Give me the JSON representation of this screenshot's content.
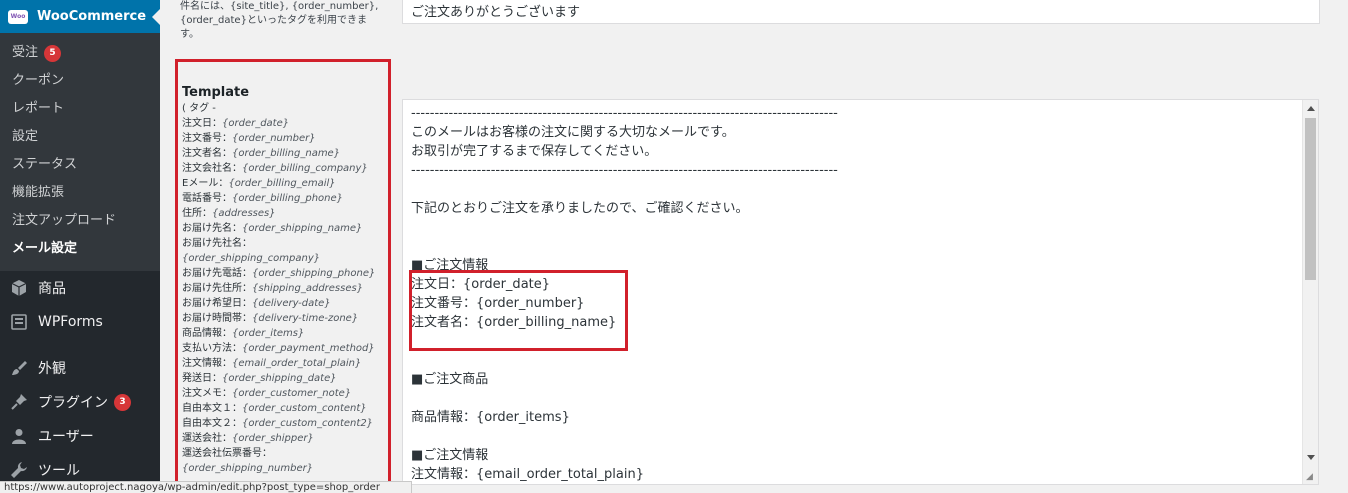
{
  "sidebar": {
    "woocommerce": {
      "logo_text": "Woo",
      "title": "WooCommerce"
    },
    "submenu": [
      {
        "label": "受注",
        "badge": "5"
      },
      {
        "label": "クーポン"
      },
      {
        "label": "レポート"
      },
      {
        "label": "設定"
      },
      {
        "label": "ステータス"
      },
      {
        "label": "機能拡張"
      },
      {
        "label": "注文アップロード"
      },
      {
        "label": "メール設定",
        "current": true
      }
    ],
    "menu": [
      {
        "label": "商品",
        "icon": "box-icon"
      },
      {
        "label": "WPForms",
        "icon": "forms-icon"
      },
      {
        "label": "外観",
        "icon": "brush-icon"
      },
      {
        "label": "プラグイン",
        "icon": "plugin-icon",
        "badge": "3"
      },
      {
        "label": "ユーザー",
        "icon": "user-icon"
      },
      {
        "label": "ツール",
        "icon": "wrench-icon"
      }
    ]
  },
  "subject": {
    "description_lines": [
      "件名には、{site_title}, {order_number},",
      "{order_date}といったタグを利用できま",
      "す。"
    ],
    "value": "ご注文ありがとうございます"
  },
  "template": {
    "title": "Template",
    "tags_heading": "( タグ -",
    "tags": [
      [
        "注文日：",
        "{order_date}"
      ],
      [
        "注文番号：",
        "{order_number}"
      ],
      [
        "注文者名：",
        "{order_billing_name}"
      ],
      [
        "注文会社名：",
        "{order_billing_company}"
      ],
      [
        "Eメール：",
        "{order_billing_email}"
      ],
      [
        "電話番号：",
        "{order_billing_phone}"
      ],
      [
        "住所：",
        "{addresses}"
      ],
      [
        "お届け先名：",
        "{order_shipping_name}"
      ],
      [
        "お届け先社名：",
        ""
      ],
      [
        "",
        "{order_shipping_company}"
      ],
      [
        "お届け先電話：",
        "{order_shipping_phone}"
      ],
      [
        "お届け先住所：",
        "{shipping_addresses}"
      ],
      [
        "お届け希望日：",
        "{delivery-date}"
      ],
      [
        "お届け時間帯：",
        "{delivery-time-zone}"
      ],
      [
        "商品情報：",
        "{order_items}"
      ],
      [
        "支払い方法：",
        "{order_payment_method}"
      ],
      [
        "注文情報：",
        "{email_order_total_plain}"
      ],
      [
        "発送日：",
        "{order_shipping_date}"
      ],
      [
        "注文メモ：",
        "{order_customer_note}"
      ],
      [
        "自由本文１：",
        "{order_custom_content}"
      ],
      [
        "自由本文２：",
        "{order_custom_content2}"
      ],
      [
        "運送会社：",
        "{order_shipper}"
      ],
      [
        "運送会社伝票番号：",
        ""
      ],
      [
        "",
        "{order_shipping_number}"
      ]
    ],
    "body_lines": [
      "-------------------------------------------------------------------------------------------",
      "このメールはお客様の注文に関する大切なメールです。",
      "お取引が完了するまで保存してください。",
      "-------------------------------------------------------------------------------------------",
      "",
      "下記のとおりご注文を承りましたので、ご確認ください。",
      "",
      "",
      "■ご注文情報",
      "注文日：{order_date}",
      "注文番号：{order_number}",
      "注文者名：{order_billing_name}",
      "",
      "",
      "■ご注文商品",
      "",
      "商品情報：{order_items}",
      "",
      "■ご注文情報",
      "注文情報：{email_order_total_plain}"
    ]
  },
  "statusbar": {
    "url": "https://www.autoproject.nagoya/wp-admin/edit.php?post_type=shop_order"
  },
  "colors": {
    "highlight": "#d1202b",
    "sidebar_bg": "#23282d",
    "woo_bg": "#0073aa"
  }
}
